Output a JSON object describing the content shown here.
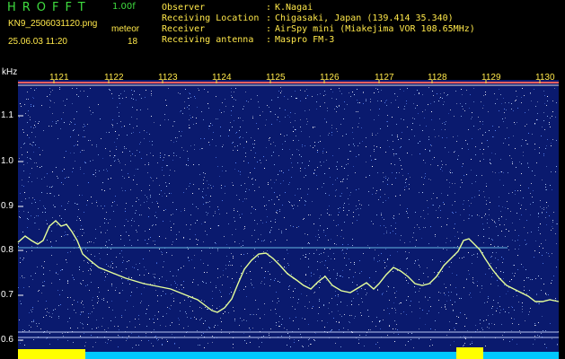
{
  "header": {
    "app_name": "HROFFT",
    "version": "1.00f",
    "filename": "KN9_2506031120.png",
    "meteor_label": "meteor",
    "datetime": "25.06.03 11:20",
    "count": "18",
    "info": [
      {
        "label": "Observer",
        "value": "K.Nagai"
      },
      {
        "label": "Receiving Location",
        "value": "Chigasaki, Japan (139.414 35.340)"
      },
      {
        "label": "Receiver",
        "value": "AirSpy mini (Miakejima VOR 108.65MHz)"
      },
      {
        "label": "Receiving antenna",
        "value": "Maspro FM-3"
      }
    ]
  },
  "axes": {
    "y_unit": "kHz",
    "x_ticks": [
      "1121",
      "1122",
      "1123",
      "1124",
      "1125",
      "1126",
      "1127",
      "1128",
      "1129",
      "1130"
    ],
    "y_ticks": [
      "1.1",
      "1.0",
      "0.9",
      "0.8",
      "0.7",
      "0.6"
    ]
  },
  "colors": {
    "background": "#000000",
    "spectrogram_bg": "#0a1a6e",
    "noise_speckle": "#ffffff",
    "trace": "#e6ff9a",
    "header_green": "#3fdc3f",
    "header_yellow": "#ffe84a",
    "level_high": "#ffff00",
    "level_low": "#00c8ff"
  }
}
